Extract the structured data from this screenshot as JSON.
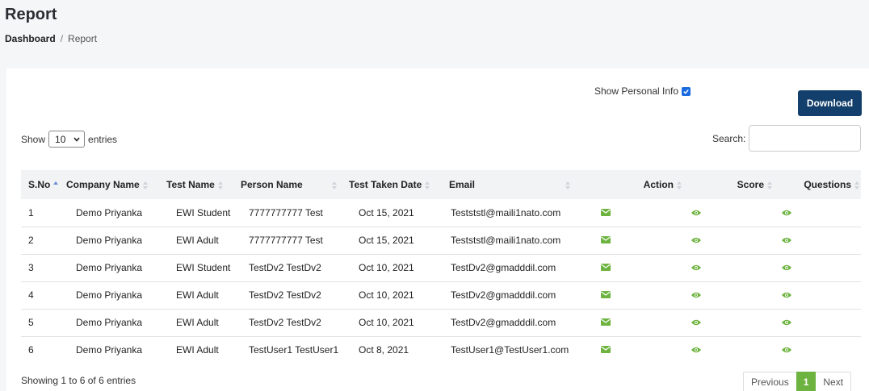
{
  "header": {
    "title": "Report",
    "breadcrumb": {
      "home": "Dashboard",
      "separator": "/",
      "current": "Report"
    }
  },
  "toolbar": {
    "show_personal_label": "Show Personal Info",
    "show_personal_checked": true,
    "download_label": "Download",
    "show_label": "Show",
    "entries_label": "entries",
    "page_length": "10",
    "search_label": "Search:",
    "search_value": ""
  },
  "table": {
    "columns": [
      "S.No",
      "Company Name",
      "Test Name",
      "Person Name",
      "Test Taken Date",
      "Email",
      "Action",
      "Score",
      "Questions"
    ],
    "rows": [
      {
        "sno": "1",
        "company": "Demo Priyanka",
        "test": "EWI Student",
        "person": "7777777777 Test",
        "date": "Oct 15, 2021",
        "email": "Testststl@maili1nato.com"
      },
      {
        "sno": "2",
        "company": "Demo Priyanka",
        "test": "EWI Adult",
        "person": "7777777777 Test",
        "date": "Oct 15, 2021",
        "email": "Testststl@maili1nato.com"
      },
      {
        "sno": "3",
        "company": "Demo Priyanka",
        "test": "EWI Student",
        "person": "TestDv2 TestDv2",
        "date": "Oct 10, 2021",
        "email": "TestDv2@gmadddil.com"
      },
      {
        "sno": "4",
        "company": "Demo Priyanka",
        "test": "EWI Adult",
        "person": "TestDv2 TestDv2",
        "date": "Oct 10, 2021",
        "email": "TestDv2@gmadddil.com"
      },
      {
        "sno": "5",
        "company": "Demo Priyanka",
        "test": "EWI Adult",
        "person": "TestDv2 TestDv2",
        "date": "Oct 10, 2021",
        "email": "TestDv2@gmadddil.com"
      },
      {
        "sno": "6",
        "company": "Demo Priyanka",
        "test": "EWI Adult",
        "person": "TestUser1 TestUser1",
        "date": "Oct 8, 2021",
        "email": "TestUser1@TestUser1.com"
      }
    ],
    "row_icons": {
      "action": "envelope-icon",
      "score": "eye-icon",
      "questions": "eye-icon"
    }
  },
  "footer": {
    "info": "Showing 1 to 6 of 6 entries",
    "previous": "Previous",
    "current_page": "1",
    "next": "Next"
  },
  "colors": {
    "primary": "#123f6b",
    "accent_green": "#6db33f",
    "checkbox": "#1a6be0"
  }
}
